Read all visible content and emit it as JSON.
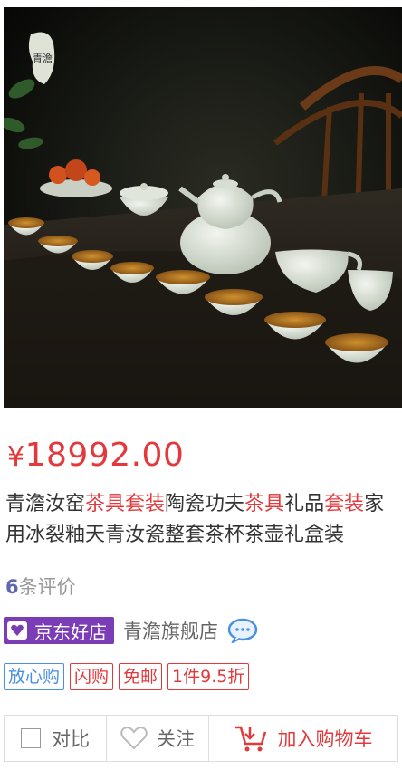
{
  "product": {
    "price_currency": "¥",
    "price_value": "18992.00",
    "title_parts": [
      {
        "text": "青澹汝窑",
        "highlight": false
      },
      {
        "text": "茶具套装",
        "highlight": true
      },
      {
        "text": "陶瓷功夫",
        "highlight": false
      },
      {
        "text": "茶具",
        "highlight": true
      },
      {
        "text": "礼品",
        "highlight": false
      },
      {
        "text": "套装",
        "highlight": true
      },
      {
        "text": "家用冰裂釉天青汝瓷整套茶杯茶壶礼盒装",
        "highlight": false
      }
    ],
    "review_count": "6",
    "review_suffix": "条评价",
    "image_logo_text": "青澹"
  },
  "shop": {
    "badge_label": "京东好店",
    "name": "青澹旗舰店",
    "chat_icon": "chat-bubble-icon"
  },
  "tags": [
    {
      "label": "放心购",
      "color": "#4a90e2"
    },
    {
      "label": "闪购",
      "color": "#e4393c"
    },
    {
      "label": "免邮",
      "color": "#e4393c"
    },
    {
      "label": "1件9.5折",
      "color": "#e4393c"
    }
  ],
  "actions": {
    "compare_label": "对比",
    "follow_label": "关注",
    "cart_label": "加入购物车"
  },
  "colors": {
    "accent_red": "#e3393c",
    "badge_purple": "#7b3db5",
    "tag_blue": "#4a90e2",
    "review_num": "#5e69ad"
  }
}
